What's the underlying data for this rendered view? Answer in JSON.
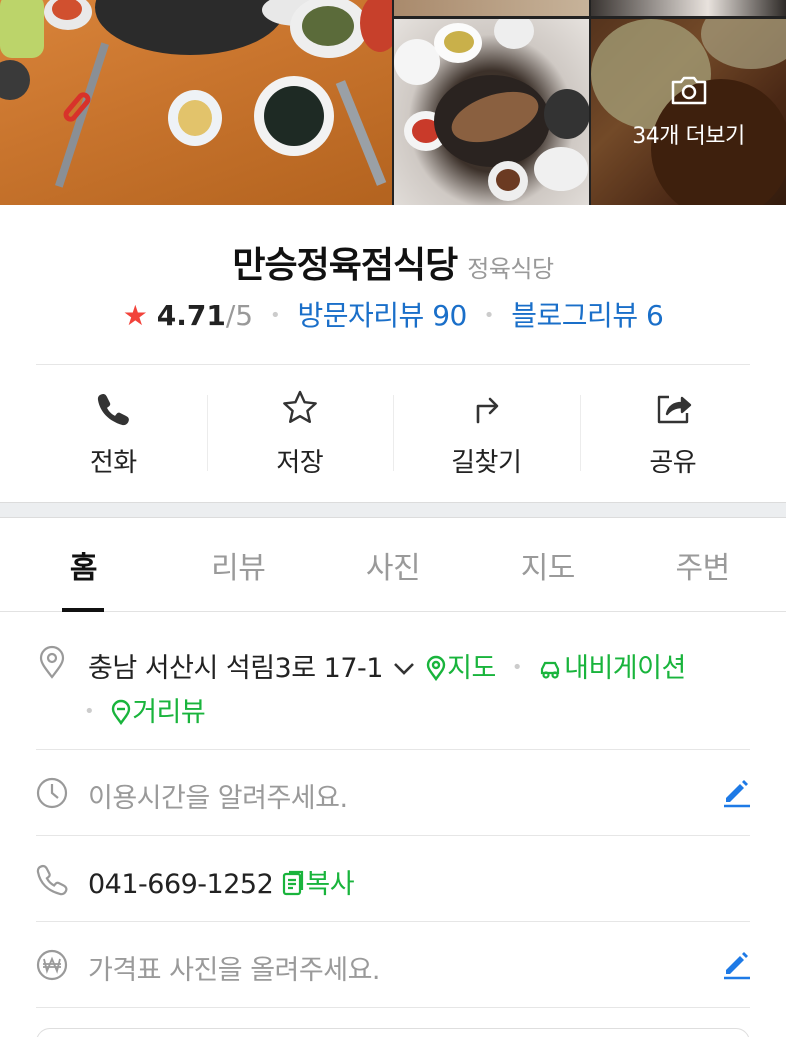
{
  "gallery": {
    "more_label": "34개 더보기",
    "more_icon": "camera-icon"
  },
  "place": {
    "name": "만승정육점식당",
    "category": "정육식당",
    "rating_star": "★",
    "rating_value": "4.71",
    "rating_max": "/5",
    "visitor_reviews": "방문자리뷰 90",
    "blog_reviews": "블로그리뷰 6"
  },
  "actions": [
    {
      "label": "전화",
      "icon": "phone-icon"
    },
    {
      "label": "저장",
      "icon": "star-icon"
    },
    {
      "label": "길찾기",
      "icon": "directions-icon"
    },
    {
      "label": "공유",
      "icon": "share-icon"
    }
  ],
  "tabs": [
    {
      "label": "홈",
      "active": true
    },
    {
      "label": "리뷰",
      "active": false
    },
    {
      "label": "사진",
      "active": false
    },
    {
      "label": "지도",
      "active": false
    },
    {
      "label": "주변",
      "active": false
    }
  ],
  "info": {
    "address": "충남 서산시 석림3로 17-1",
    "map_link": "지도",
    "navigation_link": "내비게이션",
    "street_view_link": "거리뷰",
    "hours_placeholder": "이용시간을 알려주세요.",
    "phone": "041-669-1252",
    "copy_label": "복사",
    "price_placeholder": "가격표 사진을 올려주세요."
  },
  "colors": {
    "accent_blue": "#1a6fc9",
    "accent_green": "#19b43c",
    "star_red": "#f2433b",
    "edit_blue": "#1e7ae6"
  }
}
